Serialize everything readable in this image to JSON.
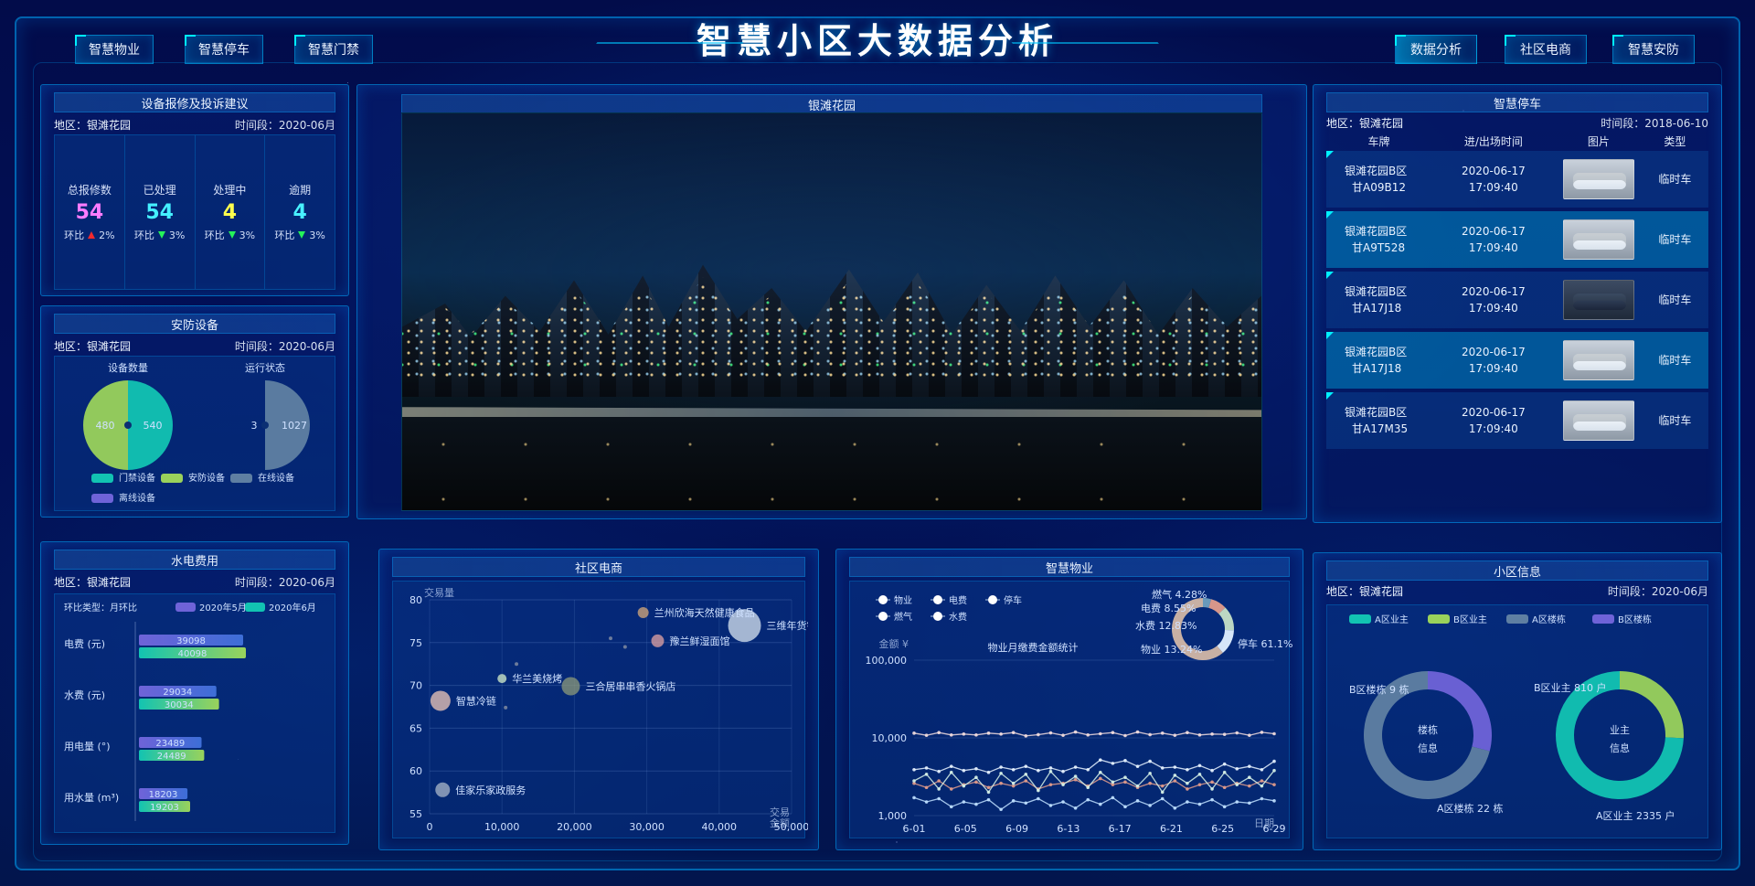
{
  "header": {
    "title": "智慧小区大数据分析",
    "left_nav": [
      "智慧物业",
      "智慧停车",
      "智慧门禁"
    ],
    "right_nav": [
      "数据分析",
      "社区电商",
      "智慧安防"
    ],
    "active_right": "数据分析"
  },
  "colors": {
    "accent": "#00c8ff",
    "teal": "#12c3b2",
    "green": "#9ad25b",
    "purple": "#6f63d8",
    "slate": "#5f7fa2",
    "warn_red": "#ff2b2b",
    "ok_green": "#27ff58"
  },
  "repair": {
    "title": "设备报修及投诉建议",
    "region": "地区：银滩花园",
    "period": "时间段：2020-06月",
    "stats": [
      {
        "label": "总报修数",
        "value": "54",
        "trend": "环比",
        "pct": "2%",
        "dir": "up",
        "color": "#ff7cff"
      },
      {
        "label": "已处理",
        "value": "54",
        "trend": "环比",
        "pct": "3%",
        "dir": "down",
        "color": "#45f0ff"
      },
      {
        "label": "处理中",
        "value": "4",
        "trend": "环比",
        "pct": "3%",
        "dir": "down",
        "color": "#ffff4d"
      },
      {
        "label": "逾期",
        "value": "4",
        "trend": "环比",
        "pct": "3%",
        "dir": "down",
        "color": "#48f1ff"
      }
    ]
  },
  "security": {
    "title": "安防设备",
    "region": "地区：银滩花园",
    "period": "时间段：2020-06月",
    "device_count_label": "设备数量",
    "status_label": "运行状态",
    "device_left_value": "480",
    "device_right_value": "540",
    "status_left_value": "3",
    "status_right_value": "1027",
    "legend": [
      {
        "name": "门禁设备",
        "color": "#12c3b2"
      },
      {
        "name": "安防设备",
        "color": "#9ad25b"
      },
      {
        "name": "在线设备",
        "color": "#5f7fa2"
      },
      {
        "name": "离线设备",
        "color": "#6f63d8"
      }
    ]
  },
  "video": {
    "title": "银滩花园"
  },
  "parking": {
    "title": "智慧停车",
    "region": "地区：银滩花园",
    "period": "时间段：2018-06-10",
    "headers": [
      "车牌",
      "进/出场时间",
      "图片",
      "类型"
    ],
    "rows": [
      {
        "location": "银滩花园B区",
        "plate": "甘A09B12",
        "date": "2020-06-17",
        "time": "17:09:40",
        "type": "临时车",
        "style": "norm",
        "img": "light"
      },
      {
        "location": "银滩花园B区",
        "plate": "甘A9T528",
        "date": "2020-06-17",
        "time": "17:09:40",
        "type": "临时车",
        "style": "alt",
        "img": "light"
      },
      {
        "location": "银滩花园B区",
        "plate": "甘A17J18",
        "date": "2020-06-17",
        "time": "17:09:40",
        "type": "临时车",
        "style": "norm",
        "img": "dark"
      },
      {
        "location": "银滩花园B区",
        "plate": "甘A17J18",
        "date": "2020-06-17",
        "time": "17:09:40",
        "type": "临时车",
        "style": "alt",
        "img": "light"
      },
      {
        "location": "银滩花园B区",
        "plate": "甘A17M35",
        "date": "2020-06-17",
        "time": "17:09:40",
        "type": "临时车",
        "style": "norm",
        "img": "light"
      }
    ]
  },
  "utilities": {
    "title": "水电费用",
    "region": "地区：银滩花园",
    "period": "时间段：2020-06月",
    "legend": {
      "type_label": "环比类型：月环比",
      "may": "2020年5月",
      "jun": "2020年6月"
    }
  },
  "ecommerce": {
    "title": "社区电商"
  },
  "property": {
    "title": "智慧物业",
    "legend": [
      "物业",
      "电费",
      "停车",
      "燃气",
      "水费"
    ],
    "y_label": "金额 ¥",
    "chart_title": "物业月缴费金额统计",
    "date_label": "日期",
    "pie": [
      {
        "label": "燃气 4.28%",
        "name": "燃气",
        "value": 4.28,
        "color": "#6f9fbf"
      },
      {
        "label": "电费 8.55%",
        "name": "电费",
        "value": 8.55,
        "color": "#e39c8b"
      },
      {
        "label": "水费 12.83%",
        "name": "水费",
        "value": 12.83,
        "color": "#c6e0c7"
      },
      {
        "label": "物业 13.24%",
        "name": "物业",
        "value": 13.24,
        "color": "#e1f0ff"
      },
      {
        "label": "停车 61.1%",
        "name": "停车",
        "value": 61.1,
        "color": "#d2b7a7"
      }
    ]
  },
  "community": {
    "title": "小区信息",
    "region": "地区：银滩花园",
    "period": "时间段：2020-06月",
    "legend": [
      {
        "name": "A区业主",
        "color": "#12c3b2"
      },
      {
        "name": "B区业主",
        "color": "#9ad25b"
      },
      {
        "name": "A区楼栋",
        "color": "#5f7fa2"
      },
      {
        "name": "B区楼栋",
        "color": "#6f63d8"
      }
    ],
    "building_center": "楼栋\n信息",
    "owner_center": "业主\n信息",
    "building_labels": [
      "B区楼栋 9 栋",
      "A区楼栋 22 栋"
    ],
    "owner_labels": [
      "B区业主 810 户",
      "A区业主 2335 户"
    ]
  },
  "chart_data": [
    {
      "type": "bar",
      "title": "",
      "xlabel": "",
      "ylabel": "",
      "categories": [
        "电费 (元)",
        "水费 (元)",
        "用电量 (°)",
        "用水量 (m³)"
      ],
      "series": [
        {
          "name": "2020年5月",
          "values": [
            39098,
            29034,
            23489,
            18203
          ]
        },
        {
          "name": "2020年6月",
          "values": [
            40098,
            30034,
            24489,
            19203
          ]
        }
      ],
      "xlim": [
        0,
        60000
      ]
    },
    {
      "type": "scatter",
      "title": "",
      "xlabel": "",
      "ylabel": "交易量",
      "x_ticks": [
        0,
        10000,
        20000,
        30000,
        40000,
        50000
      ],
      "x_tick_labels": [
        "0",
        "10,000",
        "20,000",
        "30,000",
        "40,000",
        "50,000"
      ],
      "y_ticks": [
        55,
        60,
        65,
        70,
        75,
        80
      ],
      "x_corner_label": "交易\n金额",
      "points": [
        {
          "label": "三维年货铺",
          "x": 43500,
          "y": 77.0,
          "size": 18
        },
        {
          "label": "兰州欣海天然健康食品",
          "x": 29500,
          "y": 78.5,
          "size": 6
        },
        {
          "label": "豫兰鲜湿面馆",
          "x": 31500,
          "y": 75.2,
          "size": 7
        },
        {
          "label": "华兰美烧烤",
          "x": 10000,
          "y": 70.8,
          "size": 5
        },
        {
          "label": "三合居串串香火锅店",
          "x": 19500,
          "y": 69.9,
          "size": 10
        },
        {
          "label": "智慧冷链",
          "x": 1500,
          "y": 68.2,
          "size": 11
        },
        {
          "label": "佳家乐家政服务",
          "x": 1800,
          "y": 57.8,
          "size": 8
        },
        {
          "label": "",
          "x": 27000,
          "y": 74.5,
          "size": 2
        },
        {
          "label": "",
          "x": 25000,
          "y": 75.5,
          "size": 2
        },
        {
          "label": "",
          "x": 12000,
          "y": 72.5,
          "size": 2
        },
        {
          "label": "",
          "x": 10500,
          "y": 67.4,
          "size": 2
        }
      ],
      "xlim": [
        0,
        50000
      ],
      "ylim": [
        55,
        80
      ]
    },
    {
      "type": "line",
      "title": "物业月缴费金额统计",
      "xlabel": "日期",
      "ylabel": "金额 ¥",
      "x_tick_labels": [
        "6-01",
        "6-05",
        "6-09",
        "6-13",
        "6-17",
        "6-21",
        "6-25",
        "6-29"
      ],
      "y_ticks": [
        1000,
        10000,
        100000
      ],
      "y_tick_labels": [
        "1,000",
        "10,000",
        "100,000"
      ],
      "series": [
        {
          "name": "停车",
          "values": [
            11500,
            10800,
            11700,
            10900,
            11200,
            10900,
            11500,
            11200,
            11700,
            10600,
            11000,
            11600,
            10800,
            11900,
            10900,
            11300,
            11700,
            10700,
            11900,
            11000,
            11500,
            10800,
            11700,
            10900,
            11200,
            11100,
            11600,
            10800,
            11800,
            11300
          ]
        },
        {
          "name": "物业",
          "values": [
            3900,
            4100,
            3700,
            4300,
            3800,
            4000,
            3600,
            4200,
            3900,
            4300,
            3800,
            4100,
            3700,
            4200,
            3900,
            5200,
            4700,
            5100,
            4300,
            5000,
            4100,
            4200,
            3900,
            4400,
            3800,
            4600,
            4000,
            4300,
            3900,
            5000
          ]
        },
        {
          "name": "电费",
          "values": [
            2600,
            2300,
            2800,
            2200,
            2500,
            2700,
            2300,
            2600,
            2400,
            2800,
            2200,
            2500,
            2600,
            2900,
            2400,
            3000,
            2500,
            2700,
            2300,
            2600,
            2400,
            2800,
            2200,
            2500,
            2700,
            2300,
            2600,
            2400,
            2800,
            2500
          ]
        },
        {
          "name": "水费",
          "values": [
            2800,
            3400,
            2200,
            3600,
            2400,
            3100,
            2000,
            3500,
            2600,
            3400,
            2100,
            3700,
            2500,
            3200,
            2300,
            3600,
            2700,
            3100,
            2400,
            3500,
            2000,
            3300,
            2600,
            3400,
            2200,
            3600,
            2500,
            3100,
            2400,
            3800
          ]
        },
        {
          "name": "燃气",
          "values": [
            1700,
            1500,
            1650,
            1300,
            1500,
            1400,
            1600,
            1200,
            1550,
            1450,
            1650,
            1350,
            1500,
            1250,
            1600,
            1400,
            1700,
            1300,
            1550,
            1350,
            1650,
            1250,
            1500,
            1400,
            1600,
            1300,
            1500,
            1450,
            1650,
            1550
          ]
        }
      ]
    },
    {
      "type": "pie",
      "title": "",
      "values": [
        61.1,
        13.24,
        12.83,
        8.55,
        4.28
      ],
      "labels": [
        "停车",
        "物业",
        "水费",
        "电费",
        "燃气"
      ]
    },
    {
      "type": "pie",
      "title": "楼栋信息",
      "values": [
        9,
        22
      ],
      "labels": [
        "B区楼栋",
        "A区楼栋"
      ]
    },
    {
      "type": "pie",
      "title": "业主信息",
      "values": [
        810,
        2335
      ],
      "labels": [
        "B区业主",
        "A区业主"
      ]
    }
  ]
}
